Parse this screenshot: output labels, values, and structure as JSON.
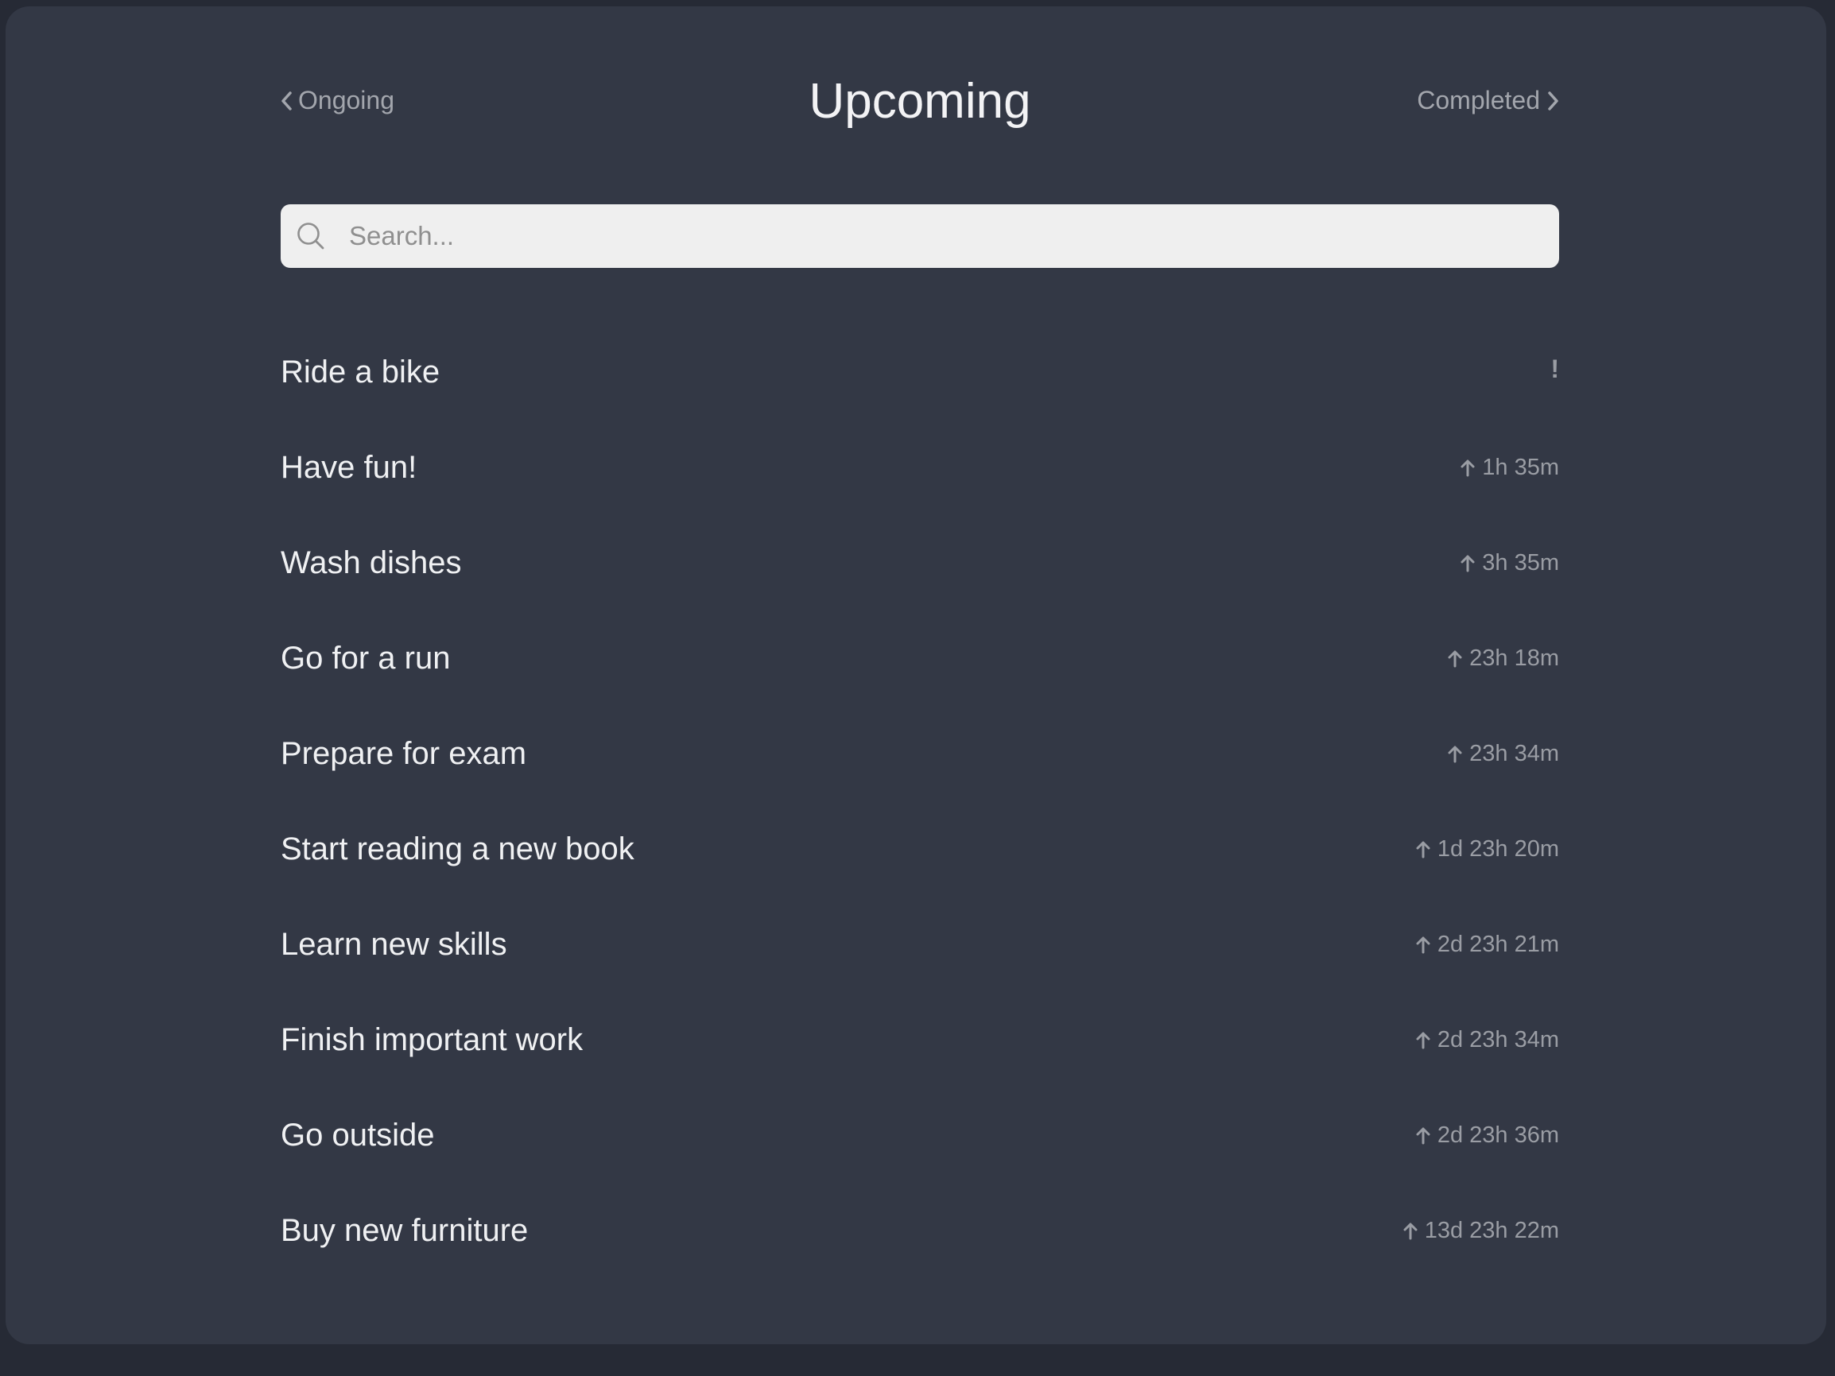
{
  "header": {
    "prev_label": "Ongoing",
    "title": "Upcoming",
    "next_label": "Completed"
  },
  "search": {
    "placeholder": "Search...",
    "value": ""
  },
  "tasks": [
    {
      "name": "Ride a bike",
      "time": "",
      "flag": "!"
    },
    {
      "name": "Have fun!",
      "time": "1h 35m"
    },
    {
      "name": "Wash dishes",
      "time": "3h 35m"
    },
    {
      "name": "Go for a run",
      "time": "23h 18m"
    },
    {
      "name": "Prepare for exam",
      "time": "23h 34m"
    },
    {
      "name": "Start reading a new book",
      "time": "1d 23h 20m"
    },
    {
      "name": "Learn new skills",
      "time": "2d 23h 21m"
    },
    {
      "name": "Finish important work",
      "time": "2d 23h 34m"
    },
    {
      "name": "Go outside",
      "time": "2d 23h 36m"
    },
    {
      "name": "Buy new furniture",
      "time": "13d 23h 22m"
    }
  ],
  "icons": {
    "prev": "chevron-left-icon",
    "next": "chevron-right-icon",
    "search": "search-icon",
    "time": "arrow-up-icon"
  },
  "colors": {
    "background": "#333845",
    "outer": "#262a35",
    "text": "#f0f1f3",
    "muted": "#9a9da4",
    "search_bg": "#efefef"
  }
}
